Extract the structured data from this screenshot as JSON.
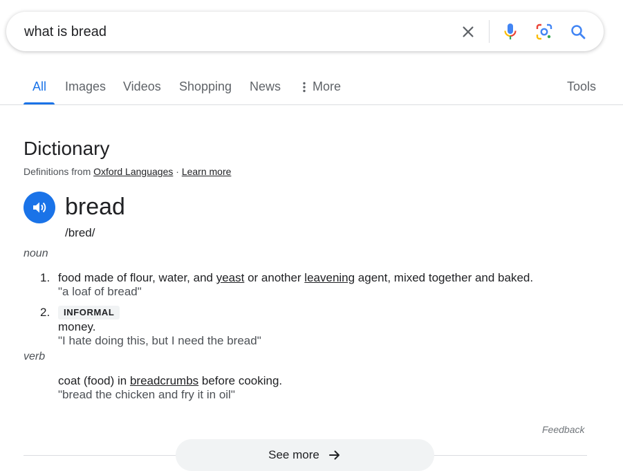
{
  "search": {
    "query": "what is bread"
  },
  "tabs": [
    {
      "label": "All",
      "active": true
    },
    {
      "label": "Images"
    },
    {
      "label": "Videos"
    },
    {
      "label": "Shopping"
    },
    {
      "label": "News"
    },
    {
      "label": "More"
    }
  ],
  "tools_label": "Tools",
  "dictionary": {
    "title": "Dictionary",
    "source_prefix": "Definitions from",
    "source_link": "Oxford Languages",
    "separator": "·",
    "learn_more": "Learn more",
    "word": "bread",
    "phonetic": "/bred/",
    "noun_label": "noun",
    "verb_label": "verb",
    "def1": {
      "number": "1.",
      "part1": "food made of flour, water, and ",
      "link1": "yeast",
      "part2": " or another ",
      "link2": "leavening",
      "part3": " agent, mixed together and baked.",
      "example": "\"a loaf of bread\""
    },
    "def2": {
      "number": "2.",
      "badge": "INFORMAL",
      "text": "money.",
      "example": "\"I hate doing this, but I need the bread\""
    },
    "def3": {
      "part1": "coat (food) in ",
      "link1": "breadcrumbs",
      "part2": " before cooking.",
      "example": "\"bread the chicken and fry it in oil\""
    }
  },
  "feedback_label": "Feedback",
  "see_more_label": "See more",
  "colors": {
    "accent": "#1a73e8",
    "text": "#202124",
    "secondary": "#4d5156"
  }
}
